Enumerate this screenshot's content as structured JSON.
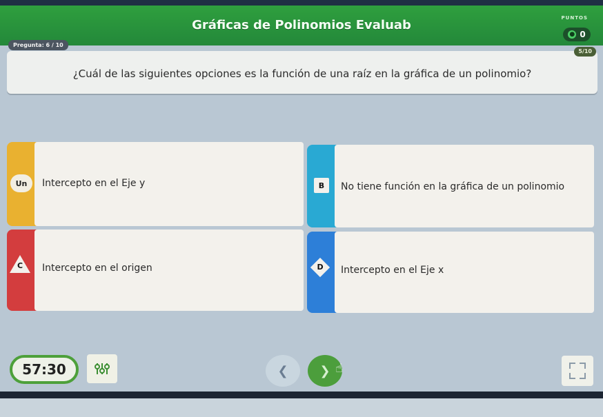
{
  "header": {
    "title": "Gráficas de Polinomios Evaluab",
    "points_label": "PUNTOS",
    "points_value": "0"
  },
  "question": {
    "counter": "Pregunta: 6 / 10",
    "progress": "5/10",
    "text": "¿Cuál de las siguientes opciones es la función de una raíz en la gráfica de un polinomio?"
  },
  "options": [
    {
      "label": "Un",
      "text": "Intercepto en el Eje y",
      "color": "#e9b130"
    },
    {
      "label": "B",
      "text": "No tiene función en la gráfica de un polinomio",
      "color": "#29a9d3"
    },
    {
      "label": "C",
      "text": "Intercepto en el origen",
      "color": "#d33d3e"
    },
    {
      "label": "D",
      "text": "Intercepto en el Eje x",
      "color": "#2d7fd8"
    }
  ],
  "footer": {
    "timer": "57:30",
    "prev_icon": "chevron-left-icon",
    "next_icon": "chevron-right-icon",
    "settings_icon": "sliders-icon",
    "fullscreen_icon": "fullscreen-icon"
  }
}
